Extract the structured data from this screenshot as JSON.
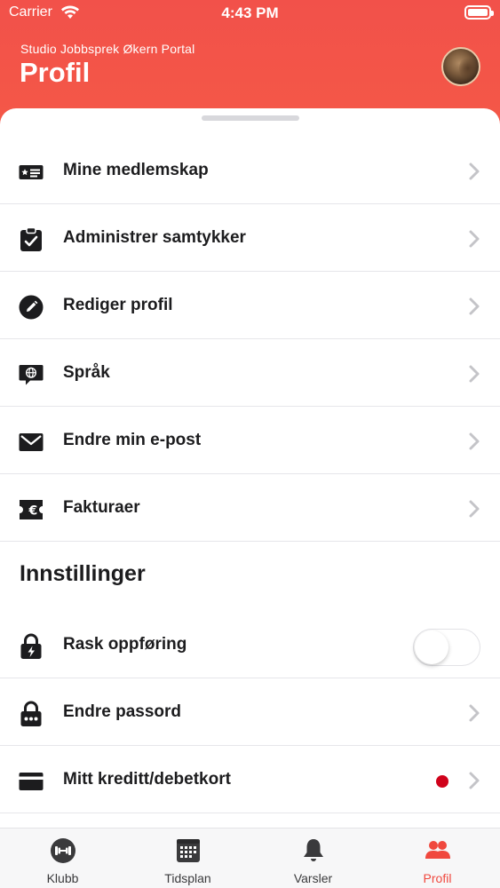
{
  "status_bar": {
    "carrier": "Carrier",
    "time": "4:43 PM"
  },
  "header": {
    "subtitle": "Studio Jobbsprek Økern Portal",
    "title": "Profil"
  },
  "menu": {
    "items": [
      {
        "label": "Mine medlemskap",
        "icon": "membership-card-icon"
      },
      {
        "label": "Administrer samtykker",
        "icon": "clipboard-check-icon"
      },
      {
        "label": "Rediger profil",
        "icon": "pencil-icon"
      },
      {
        "label": "Språk",
        "icon": "globe-chat-icon"
      },
      {
        "label": "Endre min e-post",
        "icon": "envelope-icon"
      },
      {
        "label": "Fakturaer",
        "icon": "euro-invoice-icon"
      }
    ]
  },
  "settings": {
    "title": "Innstillinger",
    "items": [
      {
        "label": "Rask oppføring",
        "icon": "lock-bolt-icon",
        "toggle": false
      },
      {
        "label": "Endre passord",
        "icon": "lock-dots-icon"
      },
      {
        "label": "Mitt kreditt/debetkort",
        "icon": "credit-card-icon",
        "badge": "red-dot"
      }
    ]
  },
  "tabbar": {
    "tabs": [
      {
        "label": "Klubb",
        "icon": "dumbbell-icon",
        "active": false
      },
      {
        "label": "Tidsplan",
        "icon": "calendar-icon",
        "active": false
      },
      {
        "label": "Varsler",
        "icon": "bell-icon",
        "active": false
      },
      {
        "label": "Profil",
        "icon": "people-icon",
        "active": true
      }
    ]
  },
  "colors": {
    "accent": "#f0483e",
    "header": "#f3524a",
    "badge": "#d0021b"
  }
}
